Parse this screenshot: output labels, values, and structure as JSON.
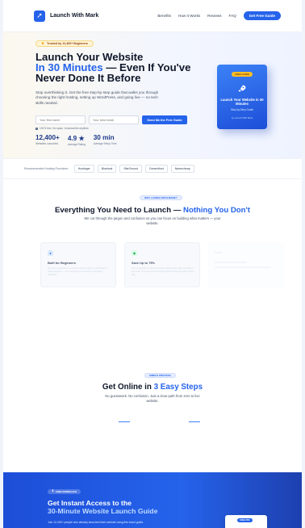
{
  "nav": {
    "brand": "Launch With Mark",
    "links": [
      "Benefits",
      "How It Works",
      "Reviews",
      "FAQ"
    ],
    "cta": "Get Free Guide"
  },
  "hero": {
    "badge": "Trusted by 12,400+ Beginners",
    "title_line1": "Launch Your Website",
    "title_accent": "In 30 Minutes",
    "title_rest": " — Even If You've Never Done It Before",
    "subtitle": "Stop overthinking it. Get the free step-by-step guide that walks you through choosing the right hosting, setting up WordPress, and going live — no tech skills needed.",
    "first_name_placeholder": "Your first name",
    "email_placeholder": "Your best email",
    "submit_label": "Send Me the Free Guide",
    "no_spam": "100% free. No spam. Unsubscribe anytime.",
    "stats": [
      {
        "value": "12,400+",
        "label": "Websites Launched"
      },
      {
        "value": "4.9 ★",
        "label": "Average Rating"
      },
      {
        "value": "30 min",
        "label": "Average Setup Time"
      }
    ],
    "book": {
      "badge": "FREE GUIDE",
      "title": "Launch Your Website in 30 Minutes",
      "subtitle": "Step-by-Step Guide",
      "author": "by Launch With Mark"
    }
  },
  "providers": {
    "label": "Recommended Hosting Providers:",
    "items": [
      "Hostinger",
      "Bluehost",
      "SiteGround",
      "DreamHost",
      "Namecheap"
    ]
  },
  "features": {
    "pill": "WHY LAUNCH WITH MARK?",
    "title_main": "Everything You Need to Launch — ",
    "title_accent": "Nothing You Don't",
    "subtitle": "We cut through the jargon and confusion so you can focus on building what matters — your website.",
    "cards": [
      {
        "title": "Built for Beginners",
        "desc": "No tech experience needed. Every step is explained in plain English — from buying a domain to pressing \"Publish.\""
      },
      {
        "title": "Save Up to 75%",
        "desc": "We negotiate exclusive hosting discounts with providers we trust. Get premium hosting without the premium price tag."
      }
    ]
  },
  "steps": {
    "pill": "SIMPLE PROCESS",
    "title_main": "Get Online in ",
    "title_accent": "3 Easy Steps",
    "subtitle": "No guesswork. No confusion. Just a clear path from zero to live website."
  },
  "cta": {
    "badge": "FREE DOWNLOAD",
    "title_line1": "Get Instant Access to the",
    "title_line2": "30-Minute Website Launch Guide",
    "subtitle": "Join 12,400+ people who already launched their website using this exact guide.",
    "card_badge": "FREE PDF"
  },
  "colors": {
    "accent": "#2563eb",
    "heading": "#0f172a",
    "badge_gold": "#fbbf24"
  }
}
